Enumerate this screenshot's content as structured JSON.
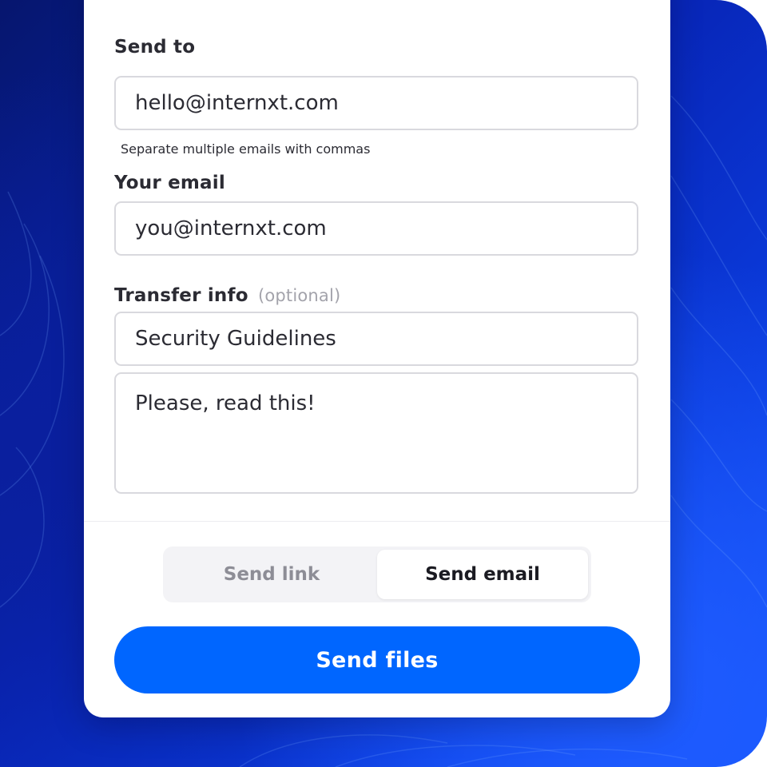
{
  "form": {
    "send_to_label": "Send to",
    "send_to_value": "hello@internxt.com",
    "send_to_hint": "Separate multiple emails with commas",
    "your_email_label": "Your email",
    "your_email_value": "you@internxt.com",
    "transfer_info_label": "Transfer info",
    "transfer_info_optional": "(optional)",
    "title_value": "Security Guidelines",
    "message_value": "Please, read this!"
  },
  "mode_toggle": {
    "options": [
      "Send link",
      "Send email"
    ],
    "selected": "Send email"
  },
  "actions": {
    "send_files_label": "Send files"
  },
  "colors": {
    "accent": "#0066ff",
    "background": "#0826b8"
  }
}
